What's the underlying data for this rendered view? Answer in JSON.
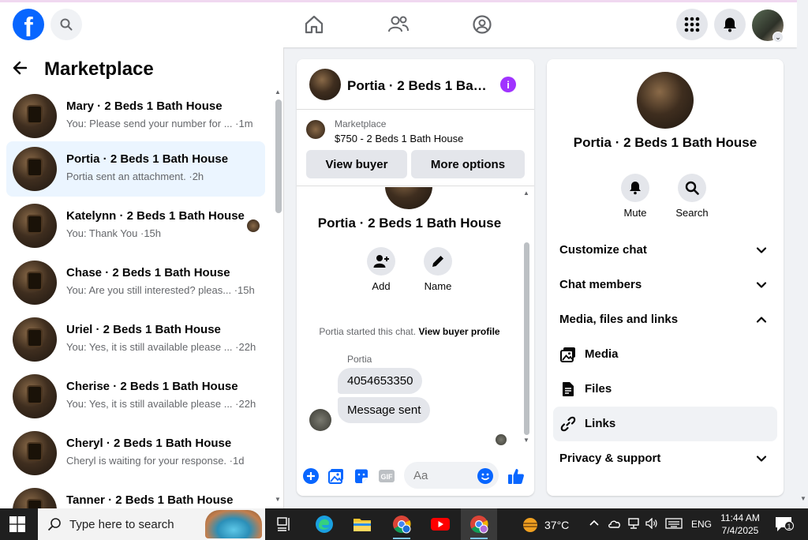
{
  "topbar": {
    "logo_letter": "f",
    "profile_caret": "⌄"
  },
  "left_panel": {
    "title": "Marketplace",
    "conversations": [
      {
        "name": "Mary · 2 Beds 1 Bath House",
        "preview": "You: Please send your number for ... ·1m",
        "active": false
      },
      {
        "name": "Portia · 2 Beds 1 Bath House",
        "preview": "Portia sent an attachment. ·2h",
        "active": true
      },
      {
        "name": "Katelynn · 2 Beds 1 Bath House",
        "preview": "You: Thank You ·15h",
        "active": false
      },
      {
        "name": "Chase · 2 Beds 1 Bath House",
        "preview": "You: Are you still interested? pleas... ·15h",
        "active": false
      },
      {
        "name": "Uriel · 2 Beds 1 Bath House",
        "preview": "You: Yes, it is still available please ... ·22h",
        "active": false
      },
      {
        "name": "Cherise · 2 Beds 1 Bath House",
        "preview": "You: Yes, it is still available please ... ·22h",
        "active": false
      },
      {
        "name": "Cheryl · 2 Beds 1 Bath House",
        "preview": "Cheryl is waiting for your response. ·1d",
        "active": false
      },
      {
        "name": "Tanner · 2 Beds 1 Bath House",
        "preview": "",
        "active": false
      }
    ]
  },
  "chat": {
    "header_name": "Portia · 2 Beds 1 Bath House",
    "info_glyph": "i",
    "listing_category": "Marketplace",
    "listing_title": "$750 - 2 Beds 1 Bath House",
    "view_buyer": "View buyer",
    "more_options": "More options",
    "profile_name": "Portia · 2 Beds 1 Bath House",
    "add_label": "Add",
    "name_label": "Name",
    "started_text": "Portia started this chat.",
    "view_buyer_profile": "View buyer profile",
    "sender": "Portia",
    "messages": [
      "4054653350",
      "Message sent"
    ],
    "input_placeholder": "Aa",
    "gif_label": "GIF"
  },
  "right_panel": {
    "name": "Portia · 2 Beds 1 Bath House",
    "mute_label": "Mute",
    "search_label": "Search",
    "sections": {
      "customize": "Customize chat",
      "members": "Chat members",
      "media_files_links": "Media, files and links",
      "media": "Media",
      "files": "Files",
      "links": "Links",
      "privacy": "Privacy & support"
    }
  },
  "taskbar": {
    "search_placeholder": "Type here to search",
    "temperature": "37°C",
    "language": "ENG",
    "time": "11:44 AM",
    "date": "7/4/2025",
    "notification_count": "1"
  },
  "colors": {
    "accent": "#0866ff",
    "active_row": "#ebf5ff",
    "info_purple": "#a033ff",
    "button_gray": "#e4e6eb"
  }
}
